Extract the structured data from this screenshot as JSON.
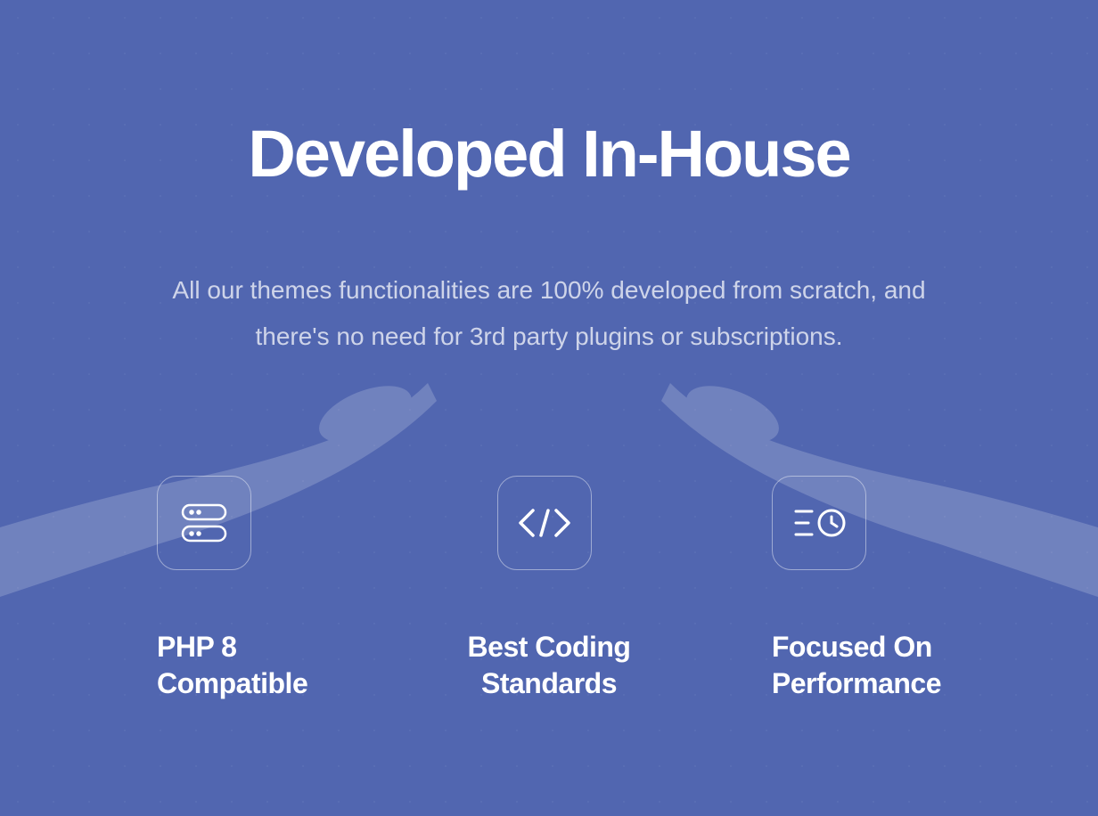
{
  "hero": {
    "title": "Developed In-House",
    "subtitle": "All our themes functionalities are 100% developed from scratch, and there's no need for 3rd party plugins or subscriptions."
  },
  "features": [
    {
      "icon": "server-icon",
      "label_line1": "PHP 8",
      "label_line2": "Compatible"
    },
    {
      "icon": "code-icon",
      "label_line1": "Best Coding",
      "label_line2": "Standards"
    },
    {
      "icon": "list-clock-icon",
      "label_line1": "Focused On",
      "label_line2": "Performance"
    }
  ],
  "colors": {
    "background": "#5166b0",
    "text_primary": "#ffffff",
    "text_secondary": "rgba(255,255,255,0.72)",
    "border": "rgba(255,255,255,0.45)"
  }
}
